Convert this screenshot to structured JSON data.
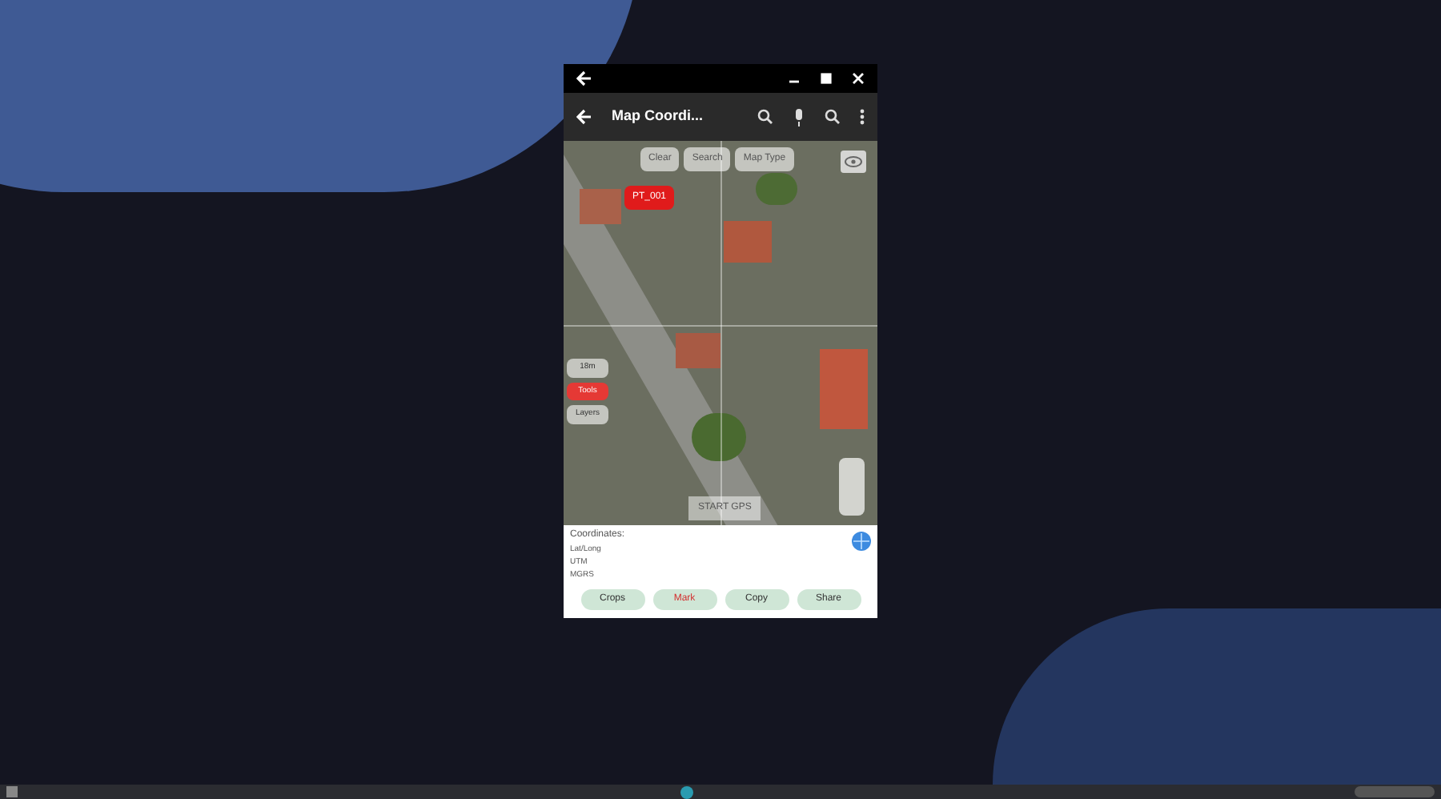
{
  "window": {
    "title_bar_buttons": [
      {
        "kind": "minimize"
      },
      {
        "kind": "maximize"
      },
      {
        "kind": "close"
      }
    ]
  },
  "toolbar": {
    "title": "Map Coordi..."
  },
  "map": {
    "buttons": [
      {
        "label": "Clear"
      },
      {
        "label": "Search"
      },
      {
        "label": "Map Type"
      }
    ],
    "marker": {
      "label": "PT_001"
    },
    "side_tools": [
      {
        "label": "18m"
      },
      {
        "label": "Tools"
      },
      {
        "label": "Layers"
      }
    ],
    "gps_button": "START GPS"
  },
  "coordinates": {
    "heading": "Coordinates:",
    "rows": [
      {
        "label": "Lat/Long"
      },
      {
        "label": "UTM"
      },
      {
        "label": "MGRS"
      }
    ]
  },
  "actions": [
    {
      "label": "Crops",
      "kind": "normal"
    },
    {
      "label": "Mark",
      "kind": "accent"
    },
    {
      "label": "Copy",
      "kind": "normal"
    },
    {
      "label": "Share",
      "kind": "normal"
    }
  ]
}
